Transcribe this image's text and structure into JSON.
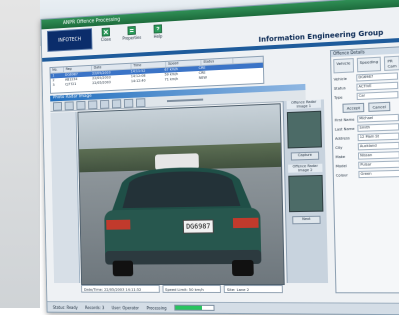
{
  "window": {
    "title": "ANPR Offence Processing",
    "group_name": "Information Engineering Group",
    "logo_text": "INFOTECH"
  },
  "toolbar": {
    "items": [
      {
        "label": "Close",
        "icon": "close-icon"
      },
      {
        "label": "Properties",
        "icon": "properties-icon"
      },
      {
        "label": "Help",
        "icon": "help-icon"
      }
    ]
  },
  "list": {
    "headers": [
      "No.",
      "Reg",
      "Date",
      "Time",
      "Speed",
      "Status"
    ],
    "rows": [
      [
        "1",
        "DG6987",
        "22/05/2003",
        "14:11:52",
        "67 km/h",
        "CRE"
      ],
      [
        "2",
        "AB1234",
        "22/05/2003",
        "14:12:08",
        "59 km/h",
        "CRE"
      ],
      [
        "3",
        "CJ7721",
        "22/05/2003",
        "14:12:40",
        "71 km/h",
        "NEW"
      ]
    ]
  },
  "photo": {
    "panel_title": "Photo Radar Image",
    "plate_text": "DG6987"
  },
  "sidestrip": {
    "thumb1_label": "Offence Radar Image 1",
    "thumb2_label": "Offence Radar Image 2",
    "btn_capture": "Capture",
    "btn_next": "Next"
  },
  "caption": {
    "field1": "Date/Time: 22/05/2003 14:11:52",
    "field2": "Speed Limit: 50 km/h",
    "field3": "Site: Lane 2"
  },
  "right_panel": {
    "title": "Offence Details",
    "tabs": [
      "Vehicle",
      "Speeding",
      "PR Cam"
    ],
    "fields": [
      {
        "label": "Vehicle",
        "value": "DG6987"
      },
      {
        "label": "Status",
        "value": "ACTIVE"
      },
      {
        "label": "Type",
        "value": "Car"
      },
      {
        "label": "First Name",
        "value": "Michael"
      },
      {
        "label": "Last Name",
        "value": "Smith"
      },
      {
        "label": "Address",
        "value": "12 Main St"
      },
      {
        "label": "City",
        "value": "Auckland"
      },
      {
        "label": "Make",
        "value": "Nissan"
      },
      {
        "label": "Model",
        "value": "Pulsar"
      },
      {
        "label": "Colour",
        "value": "Green"
      }
    ],
    "btn_accept": "Accept",
    "btn_cancel": "Cancel"
  },
  "status_bar": {
    "status": "Status: Ready",
    "records": "Records: 3",
    "user": "User: Operator",
    "progress_label": "Processing",
    "progress_fraction": 0.7
  },
  "colors": {
    "titlebar": "#1d6b3c",
    "group_bar": "#1e5b9b",
    "progress": "#28c35f",
    "car_body": "#1f4f47"
  }
}
